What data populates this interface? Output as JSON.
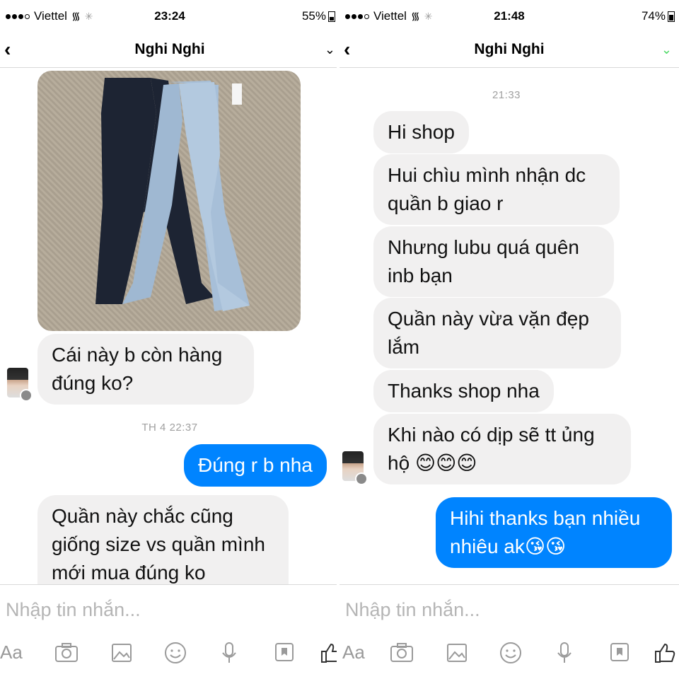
{
  "left": {
    "status": {
      "carrier": "Viettel",
      "time": "23:24",
      "battery": "55%",
      "battery_level": 0.55
    },
    "header": {
      "title": "Nghi Nghi",
      "back_icon": "chevron-left-icon",
      "menu_icon": "chevron-down-icon"
    },
    "messages": {
      "m1": "Cái này b còn hàng đúng ko?",
      "stamp": "TH 4 22:37",
      "m2": "Đúng r b nha",
      "m3": "Quần này chắc cũng giống size vs quần mình mới mua đúng ko"
    },
    "composer": {
      "placeholder": "Nhập tin nhắn...",
      "aa": "Aa"
    }
  },
  "right": {
    "status": {
      "carrier": "Viettel",
      "time": "21:48",
      "battery": "74%",
      "battery_level": 0.74
    },
    "header": {
      "title": "Nghi Nghi",
      "back_icon": "chevron-left-icon",
      "seen_icon": "check-icon"
    },
    "messages": {
      "stamp": "21:33",
      "m1": "Hi shop",
      "m2": "Hui chìu mình nhận dc quần b giao r",
      "m3": "Nhưng lubu quá quên inb bạn",
      "m4": "Quần này vừa vặn đẹp lắm",
      "m5": "Thanks shop nha",
      "m6": "Khi nào có dịp sẽ tt ủng hộ 😊😊😊",
      "m7": "Hihi thanks bạn nhiều nhiêu ak😘😘"
    },
    "composer": {
      "placeholder": "Nhập tin nhắn...",
      "aa": "Aa"
    }
  },
  "colors": {
    "outgoing": "#0084ff",
    "incoming": "#f1f0f0",
    "stamp": "#a0a0a0",
    "icon": "#9a9a9a",
    "seen": "#4cd964"
  }
}
